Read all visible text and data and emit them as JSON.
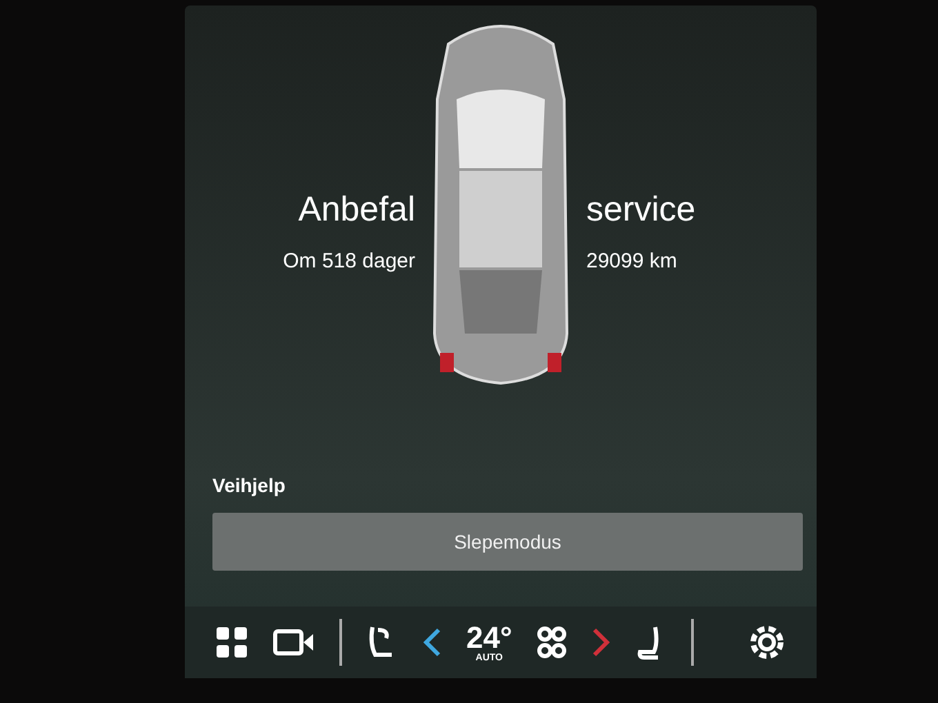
{
  "service": {
    "title_parts": [
      "Anbefal",
      "service"
    ],
    "subtitle_parts": [
      "Om 518 dager",
      "29099 km"
    ]
  },
  "section": {
    "title": "Veihjelp",
    "button": "Slepemodus"
  },
  "climate_bar": {
    "temperature": "24°",
    "mode": "AUTO"
  }
}
